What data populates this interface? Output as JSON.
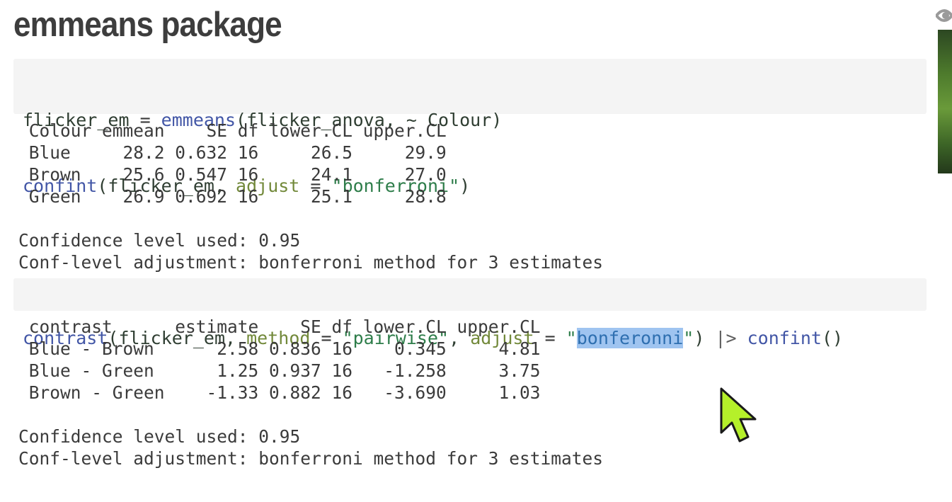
{
  "title": "emmeans package",
  "code1": {
    "line1": {
      "var": "flicker_em",
      "assign": " = ",
      "fn": "emmeans",
      "open": "(",
      "arg": "flicker_anova, ~ Colour",
      "close": ")"
    },
    "line2": {
      "fn": "confint",
      "open": "(",
      "arg": "flicker_em, ",
      "param": "adjust",
      "eq": " = ",
      "str": "\"bonferroni\"",
      "close": ")"
    }
  },
  "output1": {
    "table": " Colour emmean    SE df lower.CL upper.CL\n Blue     28.2 0.632 16     26.5     29.9\n Brown    25.6 0.547 16     24.1     27.0\n Green    26.9 0.692 16     25.1     28.8",
    "notes": "Confidence level used: 0.95\nConf-level adjustment: bonferroni method for 3 estimates"
  },
  "code2": {
    "fn": "contrast",
    "open": "(",
    "arg1": "flicker_em, ",
    "param1": "method",
    "eq1": " = ",
    "str1": "\"pairwise\"",
    "comma": ", ",
    "param2": "adjust",
    "eq2": " = ",
    "quote_open": "\"",
    "selected": "bonferonni",
    "quote_close": "\"",
    "close": ")",
    "pipe": " |> ",
    "fn2": "confint",
    "fn2_parens": "()"
  },
  "output2": {
    "table": " contrast      estimate    SE df lower.CL upper.CL\n Blue - Brown      2.58 0.836 16    0.345     4.81\n Blue - Green      1.25 0.937 16   -1.258     3.75\n Brown - Green    -1.33 0.882 16   -3.690     1.03",
    "notes": "Confidence level used: 0.95\nConf-level adjustment: bonferroni method for 3 estimates"
  },
  "colors": {
    "function": "#4256a6",
    "parameter": "#72893a",
    "string": "#2e7d4a",
    "selection": "#9fc4f0",
    "cursor": "#b5f02a"
  },
  "icons": {
    "eye": "eye-icon",
    "cursor": "mouse-cursor-icon"
  }
}
